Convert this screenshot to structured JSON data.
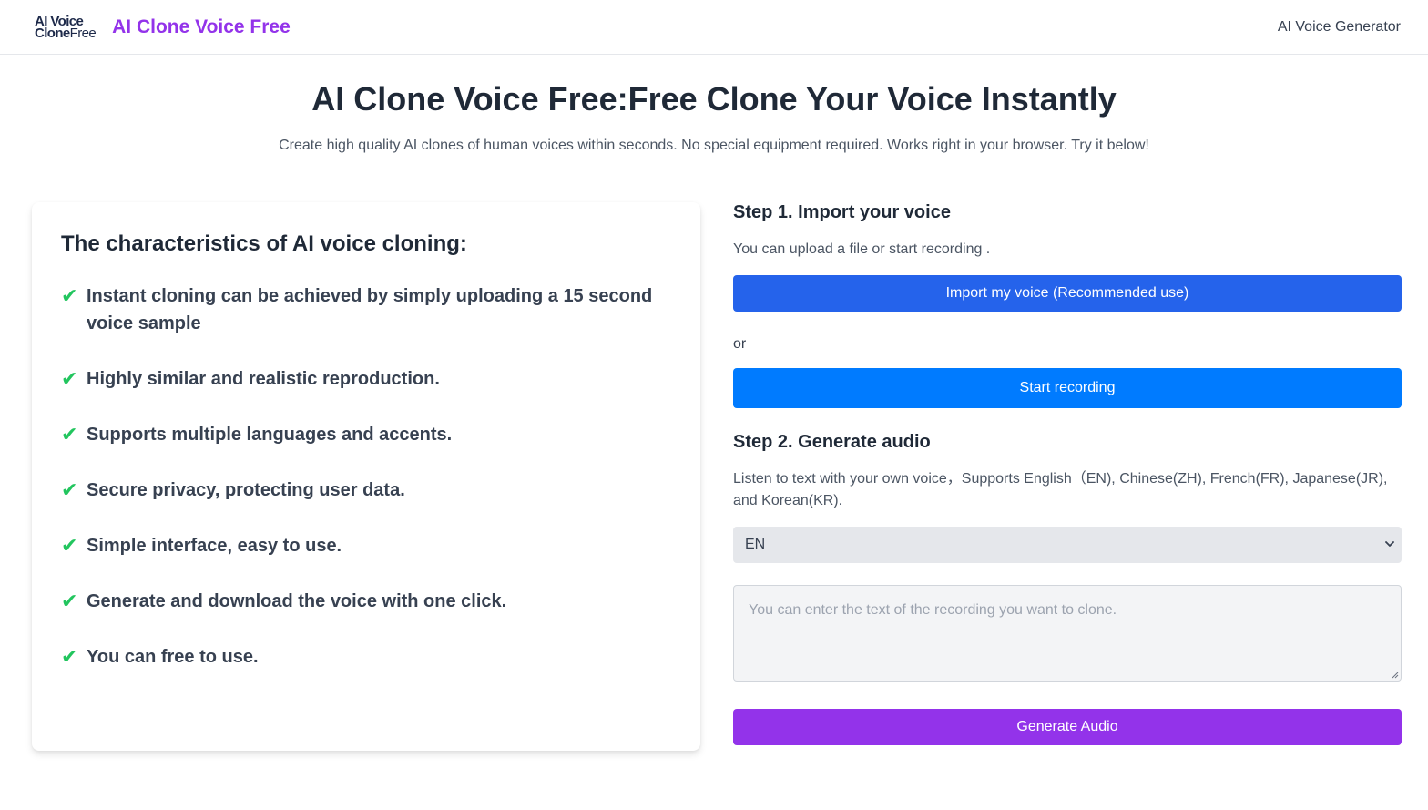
{
  "header": {
    "logo_line1": "AI Voice",
    "logo_line2_bold": "Clone",
    "logo_line2_light": "Free",
    "title": "AI Clone Voice Free",
    "nav_link": "AI Voice Generator"
  },
  "hero": {
    "title": "AI Clone Voice Free:Free Clone Your Voice Instantly",
    "subtitle": "Create high quality AI clones of human voices within seconds. No special equipment required. Works right in your browser. Try it below!"
  },
  "features": {
    "title": "The characteristics of AI voice cloning:",
    "icon": "check-icon",
    "items": [
      "Instant cloning can be achieved by simply uploading a 15 second voice sample",
      "Highly similar and realistic reproduction.",
      "Supports multiple languages and accents.",
      "Secure privacy, protecting user data.",
      "Simple interface, easy to use.",
      "Generate and download the voice with one click.",
      "You can free to use."
    ]
  },
  "step1": {
    "title": "Step 1. Import your voice",
    "desc": "You can upload a file or start recording .",
    "import_button": "Import my voice (Recommended use)",
    "or": "or",
    "record_button": "Start recording"
  },
  "step2": {
    "title": "Step 2. Generate audio",
    "desc": "Listen to text with your own voice，Supports English（EN), Chinese(ZH), French(FR), Japanese(JR), and Korean(KR).",
    "language_selected": "EN",
    "text_placeholder": "You can enter the text of the recording you want to clone.",
    "generate_button": "Generate Audio"
  },
  "colors": {
    "brand": "#9333ea",
    "import_button": "#2563eb",
    "record_button": "#007bff",
    "generate_button": "#9333ea",
    "check": "#22c55e"
  }
}
